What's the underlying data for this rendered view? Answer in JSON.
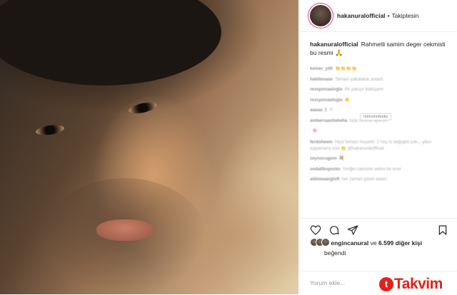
{
  "header": {
    "username": "hakanuralofficial",
    "separator": "•",
    "follow_status": "Takiptesin"
  },
  "caption": {
    "username": "hakanuralofficial",
    "text": "Rahmetli samim deger cekmisti bu resmi",
    "emoji": "🙏"
  },
  "comments": [
    {
      "user": "kemer_yilll",
      "text": "👏👏👏👏"
    },
    {
      "user": "habibisaax",
      "text": "Tamam yakalalıar anlarlt"
    },
    {
      "user": "ressponaalogla",
      "text": "Ah yakışır babişarm"
    },
    {
      "user": "ressponaalogla",
      "text": "👏"
    },
    {
      "user": "aaaaa_1",
      "text": "!!!"
    },
    {
      "user": "amberraaxtiekeha",
      "text": "bize cenme aylesın"
    },
    {
      "user": "",
      "text": "🌸"
    },
    {
      "user": "ferdoheem",
      "text": "Hiçiz bırlalız hoşartir: 2 hoç lü dağıglıb yok... yilun aşiyamanş ooo 👏 @hakanuralofficial"
    },
    {
      "user": "zeynocugem",
      "text": "💐"
    },
    {
      "user": "oodaltkopuolo",
      "text": "Yoriğin cänüme vebini ile ener"
    },
    {
      "user": "aldowaangloft",
      "text": "her zaman güzel adam"
    }
  ],
  "tooltip": "mmvonnteoks",
  "actions": {
    "icons": [
      "heart-icon",
      "comment-icon",
      "share-icon",
      "bookmark-icon"
    ]
  },
  "likes": {
    "first_user": "engincanural",
    "connector": "ve",
    "count_text": "6.599 diğer kişi",
    "suffix": "beğendi"
  },
  "add_comment": {
    "placeholder": "Yorum ekle..."
  },
  "watermark": {
    "logo_letter": "t",
    "brand_text": "Takvim",
    "color": "#e2231a"
  }
}
